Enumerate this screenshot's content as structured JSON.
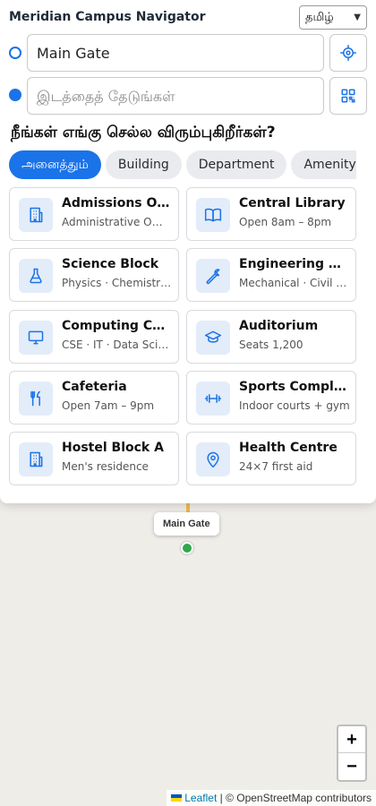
{
  "app": {
    "title": "Meridian Campus Navigator"
  },
  "language": {
    "selected": "தமிழ்"
  },
  "route": {
    "from_value": "Main Gate",
    "to_placeholder": "இடத்தைத் தேடுங்கள்"
  },
  "prompt": "நீங்கள் எங்கு செல்ல விரும்புகிறீர்கள்?",
  "filters": [
    {
      "label": "அனைத்தும்",
      "active": true
    },
    {
      "label": "Building",
      "active": false
    },
    {
      "label": "Department",
      "active": false
    },
    {
      "label": "Amenity",
      "active": false
    }
  ],
  "places": [
    {
      "name": "Admissions Office",
      "sub": "Administrative Office",
      "icon": "building-icon"
    },
    {
      "name": "Central Library",
      "sub": "Open 8am – 8pm",
      "icon": "book-icon"
    },
    {
      "name": "Science Block",
      "sub": "Physics · Chemistry · Biology",
      "icon": "flask-icon"
    },
    {
      "name": "Engineering Block",
      "sub": "Mechanical · Civil · Electrical",
      "icon": "wrench-icon"
    },
    {
      "name": "Computing Centre",
      "sub": "CSE · IT · Data Science",
      "icon": "monitor-icon"
    },
    {
      "name": "Auditorium",
      "sub": "Seats 1,200",
      "icon": "graduation-cap-icon"
    },
    {
      "name": "Cafeteria",
      "sub": "Open 7am – 9pm",
      "icon": "utensils-icon"
    },
    {
      "name": "Sports Complex",
      "sub": "Indoor courts + gym",
      "icon": "dumbbell-icon"
    },
    {
      "name": "Hostel Block A",
      "sub": "Men's residence",
      "icon": "building-icon"
    },
    {
      "name": "Health Centre",
      "sub": "24×7 first aid",
      "icon": "map-pin-icon"
    }
  ],
  "map": {
    "marker_label": "Main Gate",
    "zoom_in": "+",
    "zoom_out": "−",
    "attribution_link": "Leaflet",
    "attribution_text": "| © OpenStreetMap contributors"
  },
  "colors": {
    "accent": "#1a73e8",
    "icon_bg": "#e3ecf9",
    "route": "#f2b84b",
    "marker": "#2fa84f"
  }
}
